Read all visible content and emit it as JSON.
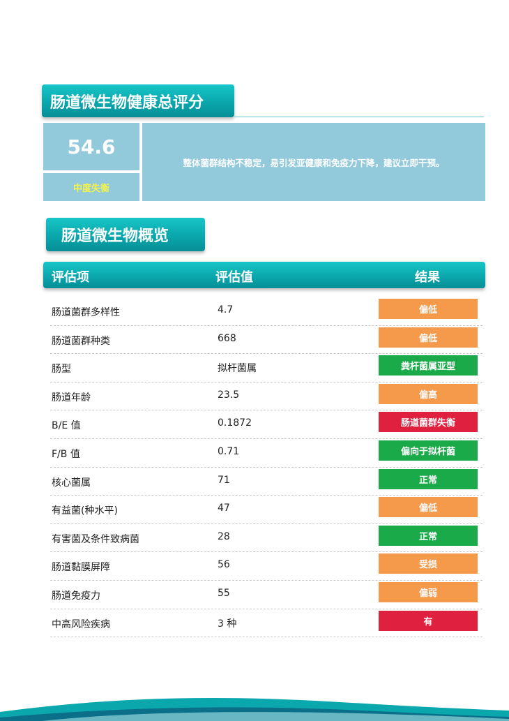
{
  "score_section": {
    "title": "肠道微生物健康总评分",
    "score": "54.6",
    "level": "中度失衡",
    "description": "整体菌群结构不稳定，易引发亚健康和免疫力下降，建议立即干预。"
  },
  "overview_section": {
    "title": "肠道微生物概览",
    "headers": {
      "item": "评估项",
      "value": "评估值",
      "result": "结果"
    },
    "rows": [
      {
        "item": "肠道菌群多样性",
        "value": "4.7",
        "result": "偏低",
        "status": "orange"
      },
      {
        "item": "肠道菌群种类",
        "value": "668",
        "result": "偏低",
        "status": "orange"
      },
      {
        "item": "肠型",
        "value": "拟杆菌属",
        "result": "粪杆菌属亚型",
        "status": "green"
      },
      {
        "item": "肠道年龄",
        "value": "23.5",
        "result": "偏高",
        "status": "orange"
      },
      {
        "item": "B/E 值",
        "value": "0.1872",
        "result": "肠道菌群失衡",
        "status": "red"
      },
      {
        "item": "F/B 值",
        "value": "0.71",
        "result": "偏向于拟杆菌",
        "status": "green"
      },
      {
        "item": "核心菌属",
        "value": "71",
        "result": "正常",
        "status": "green"
      },
      {
        "item": "有益菌(种水平)",
        "value": "47",
        "result": "偏低",
        "status": "orange"
      },
      {
        "item": "有害菌及条件致病菌",
        "value": "28",
        "result": "正常",
        "status": "green"
      },
      {
        "item": "肠道黏膜屏障",
        "value": "56",
        "result": "受损",
        "status": "orange"
      },
      {
        "item": "肠道免疫力",
        "value": "55",
        "result": "偏弱",
        "status": "orange"
      },
      {
        "item": "中高风险疾病",
        "value": "3 种",
        "result": "有",
        "status": "red"
      }
    ]
  },
  "colors": {
    "orange": "#f5994a",
    "green": "#1aaa49",
    "red": "#e0203f",
    "teal": "#0aa7ad",
    "panel": "#92cadb",
    "level_text": "#f7f34a"
  }
}
